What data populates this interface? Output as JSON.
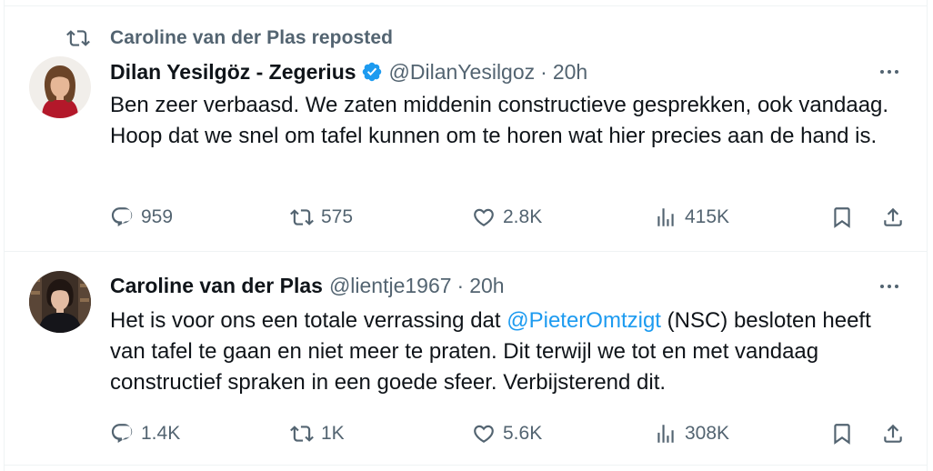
{
  "timeline": {
    "tweets": [
      {
        "social_context": "Caroline van der Plas reposted",
        "display_name": "Dilan Yesilgöz - Zegerius",
        "verified": true,
        "handle": "@DilanYesilgoz",
        "separator": "·",
        "time": "20h",
        "text": "Ben zeer verbaasd. We zaten middenin constructieve gesprekken, ook vandaag. Hoop dat we snel om tafel kunnen om te horen wat hier precies aan de hand is.",
        "stats": {
          "replies": "959",
          "reposts": "575",
          "likes": "2.8K",
          "views": "415K"
        }
      },
      {
        "display_name": "Caroline van der Plas",
        "verified": false,
        "handle": "@lientje1967",
        "separator": "·",
        "time": "20h",
        "text_before": "Het is voor ons een totale verrassing dat ",
        "mention": "@PieterOmtzigt",
        "text_after": " (NSC) besloten heeft van tafel te gaan en niet meer te praten. Dit terwijl we tot en met vandaag constructief spraken in een goede sfeer. Verbijsterend dit.",
        "stats": {
          "replies": "1.4K",
          "reposts": "1K",
          "likes": "5.6K",
          "views": "308K"
        }
      }
    ]
  },
  "icons": {
    "repost": "repost-icon",
    "reply": "reply-icon",
    "like": "heart-icon",
    "views": "views-icon",
    "bookmark": "bookmark-icon",
    "share": "share-icon",
    "more": "more-icon",
    "verified": "verified-badge-icon"
  },
  "colors": {
    "text_primary": "#0f1419",
    "text_secondary": "#536471",
    "accent": "#1d9bf0",
    "divider": "#eff3f4"
  }
}
